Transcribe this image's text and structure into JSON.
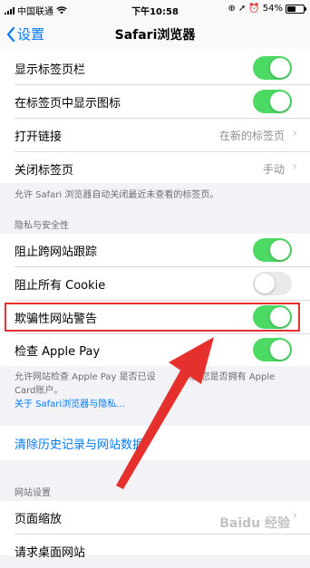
{
  "status_bar": {
    "carrier": "中国联通",
    "time": "下午10:58",
    "battery": "54%",
    "battery_fraction": 0.54
  },
  "nav": {
    "back_label": "设置",
    "title": "Safari浏览器"
  },
  "tabs_group": {
    "rows": [
      {
        "label": "显示标签页栏",
        "toggle": true
      },
      {
        "label": "在标签页中显示图标",
        "toggle": true
      },
      {
        "label": "打开链接",
        "value": "在新的标签页"
      },
      {
        "label": "关闭标签页",
        "value": "手动"
      }
    ],
    "footer": "允许 Safari 浏览器自动关闭最近未查看的标签页。"
  },
  "privacy_group": {
    "header": "隐私与安全性",
    "rows": [
      {
        "label": "阻止跨网站跟踪",
        "toggle": true
      },
      {
        "label": "阻止所有 Cookie",
        "toggle": false
      },
      {
        "label": "欺骗性网站警告",
        "toggle": true
      },
      {
        "label": "检查 Apple Pay",
        "toggle": true
      }
    ],
    "footer_line1": "允许网站检查 Apple Pay 是否已设",
    "footer_line1b": "以及您是否拥有 Apple",
    "footer_line2": "Card账户。",
    "footer_link": "关于 Safari浏览器与隐私..."
  },
  "clear_history": {
    "label": "清除历史记录与网站数据"
  },
  "website_group": {
    "header": "网站设置",
    "rows": [
      {
        "label": "页面缩放"
      },
      {
        "label": "请求桌面网站"
      }
    ]
  },
  "watermark": "Baidu 经验",
  "colors": {
    "accent": "#007aff",
    "toggle_on": "#4cd964",
    "highlight": "#e5302d"
  }
}
